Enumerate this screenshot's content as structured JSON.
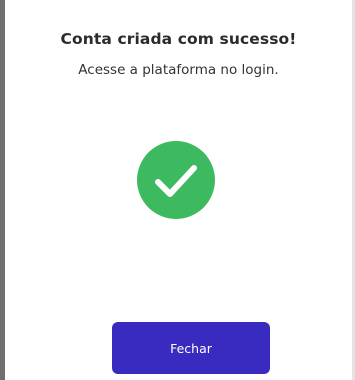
{
  "dialog": {
    "title": "Conta criada com sucesso!",
    "message": "Acesse a plataforma no login.",
    "icon": "check-circle-icon",
    "close_label": "Fechar"
  },
  "colors": {
    "success_green": "#3dba5f",
    "button_primary": "#3a2bc0",
    "left_edge": "#6f6f6f"
  }
}
